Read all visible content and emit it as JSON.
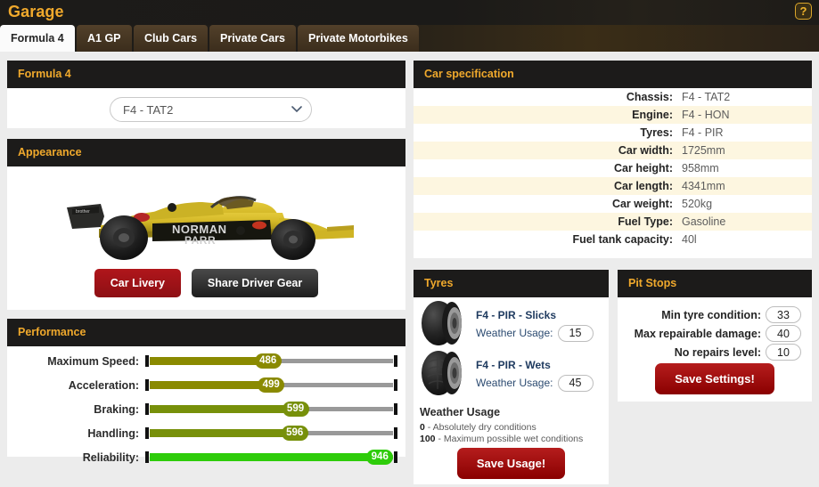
{
  "header": {
    "title": "Garage",
    "help_label": "?"
  },
  "tabs": [
    {
      "label": "Formula 4",
      "active": true
    },
    {
      "label": "A1 GP",
      "active": false
    },
    {
      "label": "Club Cars",
      "active": false
    },
    {
      "label": "Private Cars",
      "active": false
    },
    {
      "label": "Private Motorbikes",
      "active": false
    }
  ],
  "car_select_panel": {
    "title": "Formula 4",
    "selected_car": "F4 - TAT2",
    "options": [
      "F4 - TAT2"
    ]
  },
  "appearance": {
    "title": "Appearance",
    "livery_text_top": "NORMAN",
    "livery_text_bottom": "PARR",
    "car_livery_button": "Car Livery",
    "share_driver_gear_button": "Share Driver Gear"
  },
  "performance": {
    "title": "Performance",
    "max_value": 1000,
    "rows": [
      {
        "label": "Maximum Speed:",
        "value": 486,
        "color": "#8a8a00"
      },
      {
        "label": "Acceleration:",
        "value": 499,
        "color": "#8a8a00"
      },
      {
        "label": "Braking:",
        "value": 599,
        "color": "#77900a"
      },
      {
        "label": "Handling:",
        "value": 596,
        "color": "#77900a"
      },
      {
        "label": "Reliability:",
        "value": 946,
        "color": "#2ecc0a"
      }
    ]
  },
  "car_specification": {
    "title": "Car specification",
    "rows": [
      {
        "key": "Chassis:",
        "value": "F4 - TAT2"
      },
      {
        "key": "Engine:",
        "value": "F4 - HON"
      },
      {
        "key": "Tyres:",
        "value": "F4 - PIR"
      },
      {
        "key": "Car width:",
        "value": "1725mm"
      },
      {
        "key": "Car height:",
        "value": "958mm"
      },
      {
        "key": "Car length:",
        "value": "4341mm"
      },
      {
        "key": "Car weight:",
        "value": "520kg"
      },
      {
        "key": "Fuel Type:",
        "value": "Gasoline"
      },
      {
        "key": "Fuel tank capacity:",
        "value": "40l"
      }
    ]
  },
  "tyres": {
    "title": "Tyres",
    "items": [
      {
        "name": "F4 - PIR - Slicks",
        "usage_label": "Weather Usage:",
        "usage_value": "15",
        "type": "slick"
      },
      {
        "name": "F4 - PIR - Wets",
        "usage_label": "Weather Usage:",
        "usage_value": "45",
        "type": "wet"
      }
    ],
    "legend_title": "Weather Usage",
    "legend_min_num": "0",
    "legend_min_text": " - Absolutely dry conditions",
    "legend_max_num": "100",
    "legend_max_text": " - Maximum possible wet conditions",
    "save_button": "Save Usage!"
  },
  "pit_stops": {
    "title": "Pit Stops",
    "rows": [
      {
        "label": "Min tyre condition:",
        "value": "33"
      },
      {
        "label": "Max repairable damage:",
        "value": "40"
      },
      {
        "label": "No repairs level:",
        "value": "10"
      }
    ],
    "save_button": "Save Settings!"
  },
  "colors": {
    "accent": "#f0a92c",
    "panel_header_bg": "#1c1b1a",
    "page_bg": "#ececec",
    "red_button": "#8d0f14",
    "spec_alt_row": "#fdf6e0"
  }
}
